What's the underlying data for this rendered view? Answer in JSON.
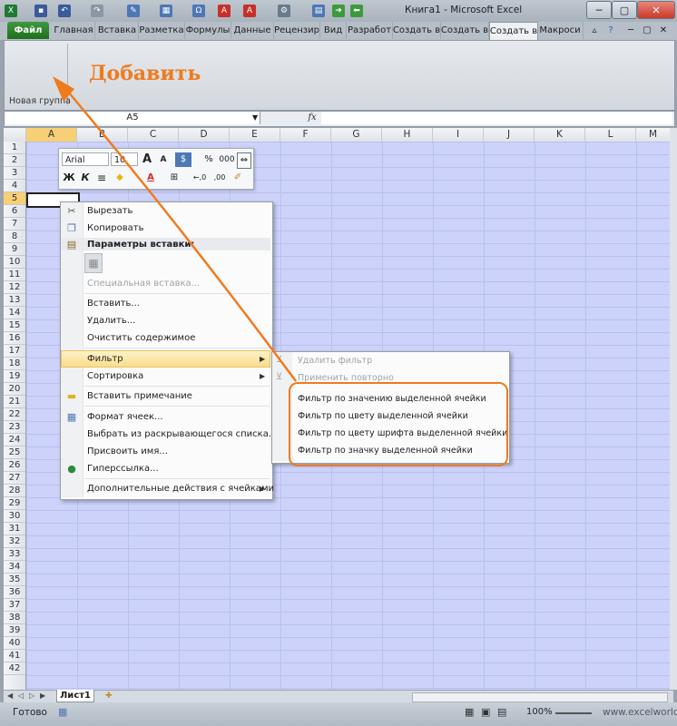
{
  "titlebar": {
    "title": "Книга1 - Microsoft Excel",
    "min": "─",
    "max": "▢",
    "close": "✕"
  },
  "tabs": [
    {
      "label": "Файл"
    },
    {
      "label": "Главная"
    },
    {
      "label": "Вставка"
    },
    {
      "label": "Разметка"
    },
    {
      "label": "Формулы"
    },
    {
      "label": "Данные"
    },
    {
      "label": "Рецензир"
    },
    {
      "label": "Вид"
    },
    {
      "label": "Разработ"
    },
    {
      "label": "Создать в"
    },
    {
      "label": "Создать в"
    },
    {
      "label": "Создать в"
    },
    {
      "label": "Макроси"
    }
  ],
  "ribbon": {
    "group_label": "Новая группа",
    "annotation": "Добавить"
  },
  "formula_bar": {
    "namebox": "A5",
    "fx": "fx",
    "value": ""
  },
  "columns": [
    "A",
    "B",
    "C",
    "D",
    "E",
    "F",
    "G",
    "H",
    "I",
    "J",
    "K",
    "L",
    "M"
  ],
  "rows": [
    "1",
    "2",
    "3",
    "4",
    "5",
    "6",
    "7",
    "8",
    "9",
    "10",
    "11",
    "12",
    "13",
    "14",
    "15",
    "16",
    "17",
    "18",
    "19",
    "20",
    "21",
    "22",
    "23",
    "24",
    "25",
    "26",
    "27",
    "28",
    "29",
    "30",
    "31",
    "32",
    "33",
    "34",
    "35",
    "36",
    "37",
    "38",
    "39",
    "40",
    "41",
    "42"
  ],
  "mini_toolbar": {
    "font": "Arial",
    "size": "10",
    "bold": "Ж",
    "italic": "К",
    "percent": "%",
    "thousands": "000",
    "grow": "A",
    "shrink": "A",
    "dec_more": "←,0",
    "dec_less": ",00"
  },
  "context_menu": {
    "cut": "Вырезать",
    "copy": "Копировать",
    "paste_options": "Параметры вставки:",
    "paste_special": "Специальная вставка...",
    "insert": "Вставить...",
    "delete": "Удалить...",
    "clear": "Очистить содержимое",
    "filter": "Фильтр",
    "sort": "Сортировка",
    "comment": "Вставить примечание",
    "format_cells": "Формат ячеек...",
    "pick_list": "Выбрать из раскрывающегося списка...",
    "name": "Присвоить имя...",
    "hyperlink": "Гиперссылка...",
    "more_actions": "Дополнительные действия с ячейками"
  },
  "submenu": {
    "remove_filter": "Удалить фильтр",
    "reapply": "Применить повторно",
    "by_value": "Фильтр по значению выделенной ячейки",
    "by_color": "Фильтр по цвету выделенной ячейки",
    "by_font_color": "Фильтр по цвету шрифта выделенной ячейки",
    "by_icon": "Фильтр по значку выделенной ячейки"
  },
  "sheet_tab": "Лист1",
  "status": {
    "ready": "Готово",
    "zoom": "100%",
    "site": "www.excelworld.ru"
  },
  "colors": {
    "accent": "#f07a1e",
    "file_tab": "#2a8429",
    "cells": "#ccd2fa"
  }
}
